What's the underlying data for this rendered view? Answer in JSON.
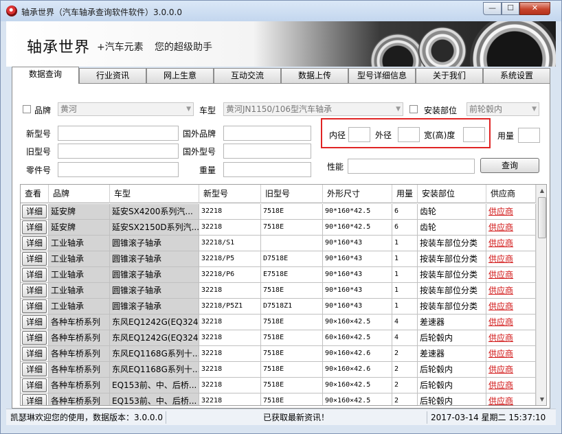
{
  "window": {
    "title": "轴承世界（汽车轴承查询软件软件）3.0.0.0",
    "minimize": "—",
    "maximize": "☐",
    "close": "✕"
  },
  "banner": {
    "title": "轴承世界",
    "subtitle1": "+汽车元素",
    "subtitle2": "您的超级助手"
  },
  "tabs": [
    "数据查询",
    "行业资讯",
    "网上生意",
    "互动交流",
    "数据上传",
    "型号详细信息",
    "关于我们",
    "系统设置"
  ],
  "filters": {
    "brand_label": "品牌",
    "brand_value": "黄河",
    "model_label": "车型",
    "model_value": "黄河JN1150/106型汽车轴承",
    "position_label": "安装部位",
    "position_value": "前轮毂内",
    "new_no_label": "新型号",
    "old_no_label": "旧型号",
    "part_no_label": "零件号",
    "foreign_brand_label": "国外品牌",
    "foreign_model_label": "国外型号",
    "weight_label": "重量",
    "inner_label": "内径",
    "outer_label": "外径",
    "width_label": "宽(高)度",
    "usage_label": "用量",
    "performance_label": "性能",
    "query_button": "查询"
  },
  "table": {
    "detail_label": "详细",
    "headers": [
      "查看",
      "品牌",
      "车型",
      "新型号",
      "旧型号",
      "外形尺寸",
      "用量",
      "安装部位",
      "供应商"
    ],
    "rows": [
      [
        "延安牌",
        "延安SX4200系列汽...",
        "32218",
        "7518E",
        "90*160*42.5",
        "6",
        "齿轮",
        "供应商"
      ],
      [
        "延安牌",
        "延安SX2150D系列汽...",
        "32218",
        "7518E",
        "90*160*42.5",
        "6",
        "齿轮",
        "供应商"
      ],
      [
        "工业轴承",
        "圆锥滚子轴承",
        "32218/S1",
        "",
        "90*160*43",
        "1",
        "按装车部位分类",
        "供应商"
      ],
      [
        "工业轴承",
        "圆锥滚子轴承",
        "32218/P5",
        "D7518E",
        "90*160*43",
        "1",
        "按装车部位分类",
        "供应商"
      ],
      [
        "工业轴承",
        "圆锥滚子轴承",
        "32218/P6",
        "E7518E",
        "90*160*43",
        "1",
        "按装车部位分类",
        "供应商"
      ],
      [
        "工业轴承",
        "圆锥滚子轴承",
        "32218",
        "7518E",
        "90*160*43",
        "1",
        "按装车部位分类",
        "供应商"
      ],
      [
        "工业轴承",
        "圆锥滚子轴承",
        "32218/P5Z1",
        "D7518Z1",
        "90*160*43",
        "1",
        "按装车部位分类",
        "供应商"
      ],
      [
        "各种车桥系列",
        "东风EQ1242G(EQ324...",
        "32218",
        "7518E",
        "90×160×42.5",
        "4",
        "差速器",
        "供应商"
      ],
      [
        "各种车桥系列",
        "东风EQ1242G(EQ324...",
        "32218",
        "7518E",
        "60×160×42.5",
        "4",
        "后轮毂内",
        "供应商"
      ],
      [
        "各种车桥系列",
        "东风EQ1168G系列十...",
        "32218",
        "7518E",
        "90×160×42.6",
        "2",
        "差速器",
        "供应商"
      ],
      [
        "各种车桥系列",
        "东风EQ1168G系列十...",
        "32218",
        "7518E",
        "90×160×42.6",
        "2",
        "后轮毂内",
        "供应商"
      ],
      [
        "各种车桥系列",
        "EQ153前、中、后桥...",
        "32218",
        "7518E",
        "90×160×42.5",
        "2",
        "后轮毂内",
        "供应商"
      ],
      [
        "各种车桥系列",
        "EQ153前、中、后桥...",
        "32218",
        "7518E",
        "90×160×42.5",
        "2",
        "后轮毂内",
        "供应商"
      ]
    ]
  },
  "status": {
    "left": "凯瑟琳欢迎您的使用，数据版本：3.0.0.0",
    "middle": "已获取最新资讯！",
    "right": "2017-03-14 星期二 15:37:10"
  }
}
